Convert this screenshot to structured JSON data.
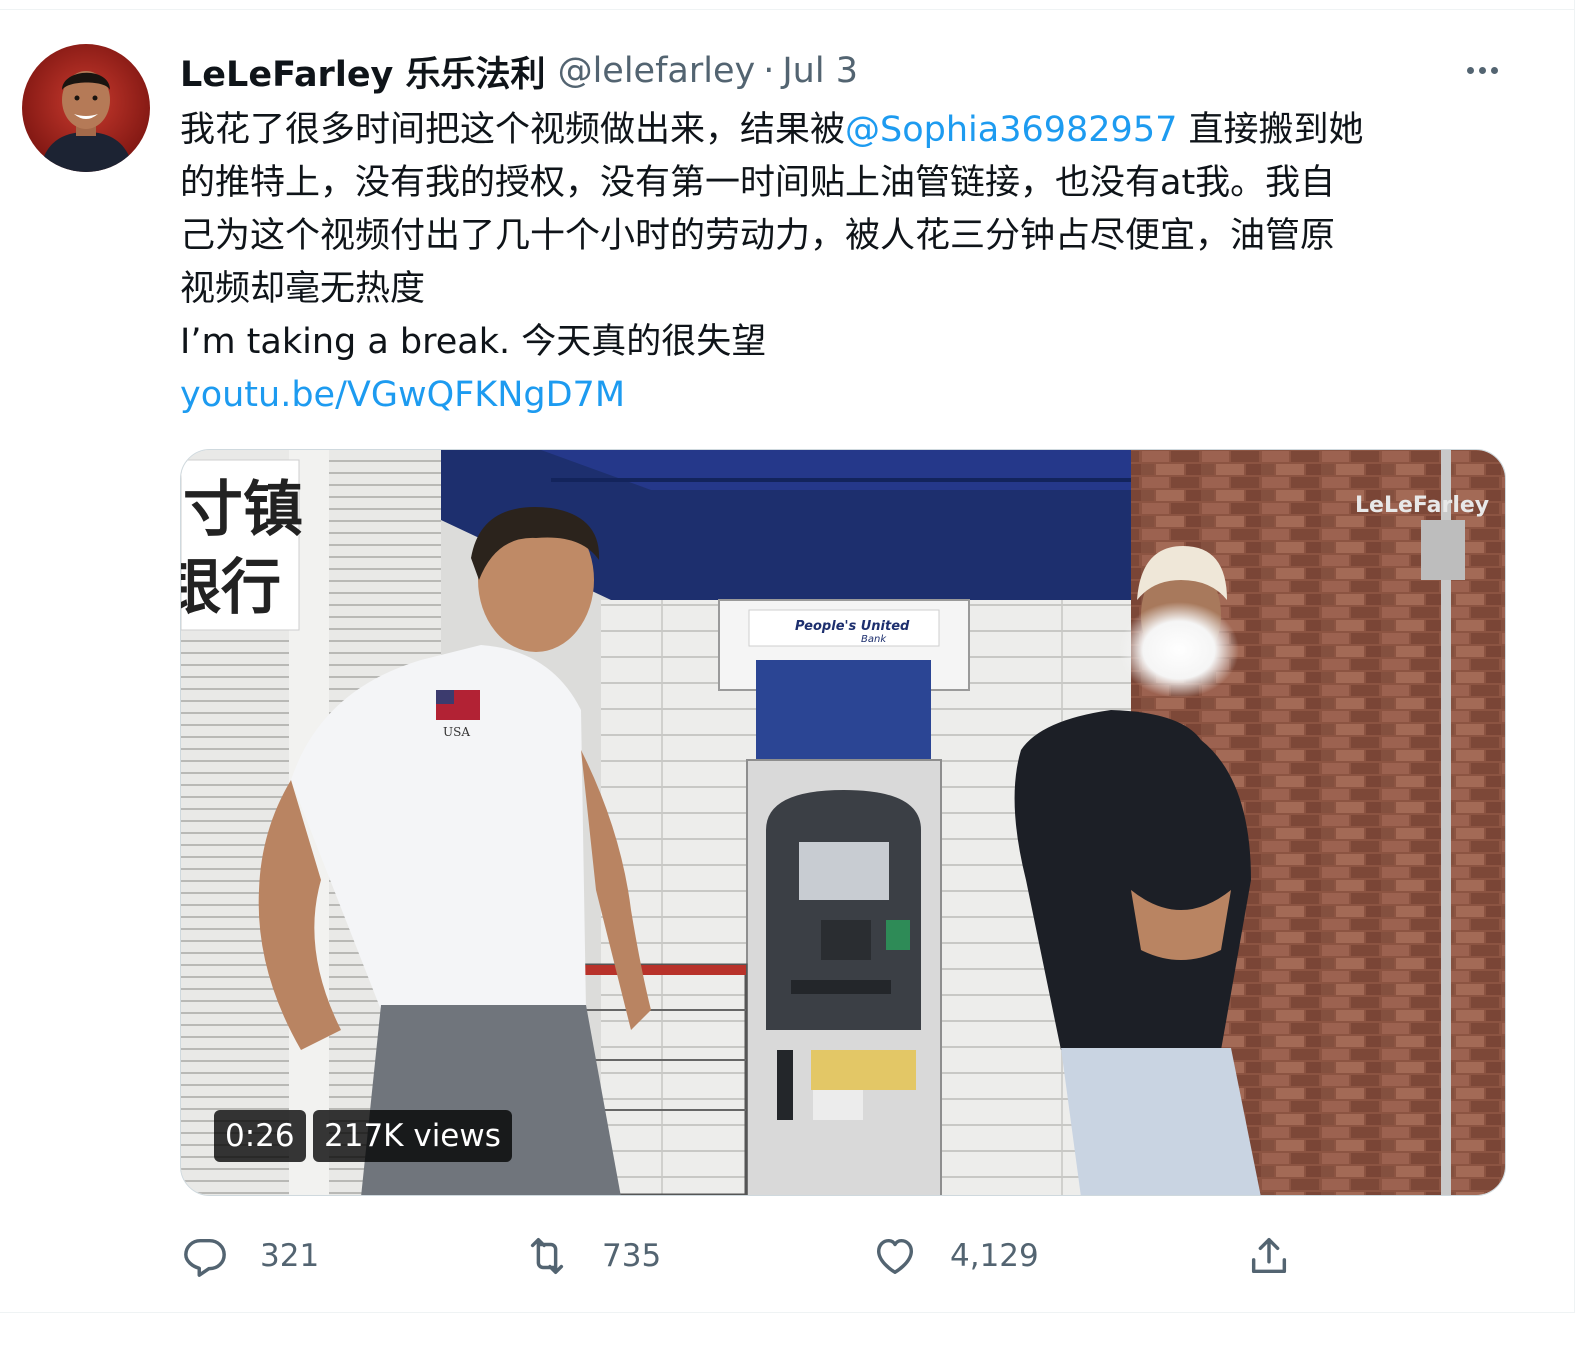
{
  "tweet": {
    "author": {
      "display_name": "LeLeFarley 乐乐法利",
      "handle": "@lelefarley",
      "separator": "·",
      "date": "Jul 3"
    },
    "text": {
      "line1_before": "我花了很多时间把这个视频做出来，结果被",
      "mention": "@Sophia36982957",
      "line1_after": " 直接搬到她",
      "line2": "的推特上，没有我的授权，没有第一时间贴上油管链接，也没有at我。我自",
      "line3": "己为这个视频付出了几十个小时的劳动力，被人花三分钟占尽便宜，油管原",
      "line4": "视频却毫无热度",
      "line5": "I’m taking a break. 今天真的很失望",
      "link": "youtu.be/VGwQFKNgD7M"
    },
    "media": {
      "duration": "0:26",
      "views": "217K views",
      "sign_lines": [
        "寸镇",
        "银行"
      ],
      "atm_brand": "People's United",
      "atm_brand_sub": "Bank",
      "shirt_text": "USA",
      "watermark": "LeLeFarley"
    },
    "actions": {
      "reply_count": "321",
      "retweet_count": "735",
      "like_count": "4,129"
    }
  },
  "colors": {
    "accent": "#1d9bf0",
    "secondary_text": "#536471",
    "primary_text": "#0f1419"
  },
  "icons": [
    "more-icon",
    "reply-icon",
    "retweet-icon",
    "like-icon",
    "share-icon"
  ]
}
